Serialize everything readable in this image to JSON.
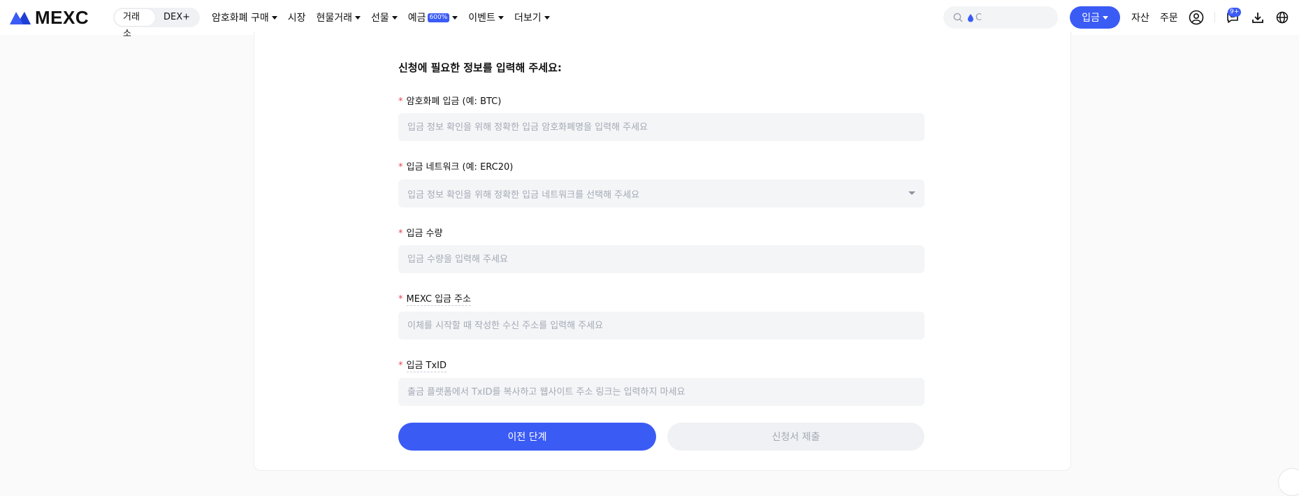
{
  "header": {
    "logo_text": "MEXC",
    "segments": [
      {
        "label": "거래소",
        "active": true
      },
      {
        "label": "DEX+",
        "active": false
      }
    ],
    "nav": [
      {
        "label": "암호화폐 구매",
        "has_caret": true
      },
      {
        "label": "시장",
        "has_caret": false
      },
      {
        "label": "현물거래",
        "has_caret": true
      },
      {
        "label": "선물",
        "has_caret": true
      },
      {
        "label": "예금",
        "badge": "600%",
        "has_caret": true
      },
      {
        "label": "이벤트",
        "has_caret": true
      },
      {
        "label": "더보기",
        "has_caret": true
      }
    ],
    "search_placeholder": "C",
    "deposit_label": "입금",
    "assets_label": "자산",
    "orders_label": "주문",
    "notification_count": "9+",
    "accent_color": "#3b5bf5"
  },
  "form": {
    "title": "신청에 필요한 정보를 입력해 주세요:",
    "fields": [
      {
        "label": "암호화폐 입금 (예: BTC)",
        "placeholder": "입금 정보 확인을 위해 정확한 입금 암호화폐명을 입력해 주세요",
        "type": "input",
        "dashed": false
      },
      {
        "label": "입금 네트워크 (예: ERC20)",
        "placeholder": "입금 정보 확인을 위해 정확한 입금 네트워크를 선택해 주세요",
        "type": "select",
        "dashed": false
      },
      {
        "label": "입금 수량",
        "placeholder": "입금 수량을 입력해 주세요",
        "type": "input",
        "dashed": false
      },
      {
        "label": "MEXC 입금 주소",
        "placeholder": "이체를 시작할 때 작성한 수신 주소를 입력해 주세요",
        "type": "input",
        "dashed": true
      },
      {
        "label": "입금 TxID",
        "placeholder": "출금 플랫폼에서 TxID를 복사하고 웹사이트 주소 링크는 입력하지 마세요",
        "type": "input",
        "dashed": true
      }
    ],
    "required_mark": "*",
    "prev_button": "이전 단계",
    "submit_button": "신청서 제출"
  }
}
